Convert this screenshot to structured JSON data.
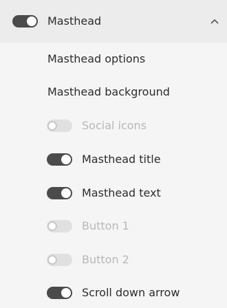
{
  "section": {
    "title": "Masthead",
    "enabled": true,
    "expanded": true,
    "collapse_icon": "chevron-up-icon"
  },
  "links": [
    {
      "label": "Masthead options"
    },
    {
      "label": "Masthead background"
    }
  ],
  "toggles": [
    {
      "label": "Social icons",
      "enabled": false
    },
    {
      "label": "Masthead title",
      "enabled": true
    },
    {
      "label": "Masthead text",
      "enabled": true
    },
    {
      "label": "Button 1",
      "enabled": false
    },
    {
      "label": "Button 2",
      "enabled": false
    },
    {
      "label": "Scroll down arrow",
      "enabled": true
    }
  ],
  "colors": {
    "toggle_on": "#4b4b4b",
    "toggle_off": "#e0e0e0",
    "text": "#2c2c2c",
    "text_disabled": "#b8b8b8",
    "header_bg": "#ececec",
    "panel_bg": "#f5f5f5"
  }
}
